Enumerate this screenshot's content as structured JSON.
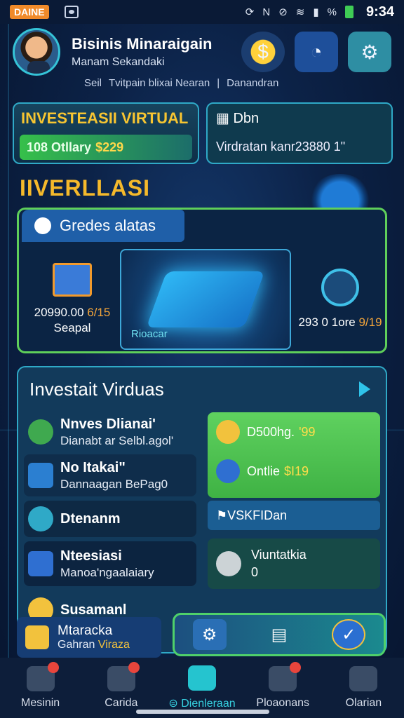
{
  "status": {
    "carrier": "DAINE",
    "time": "9:34",
    "icons": [
      "sync-icon",
      "n-icon",
      "signal-off-icon",
      "wifi-icon",
      "signal-icon",
      "percent-icon",
      "battery-icon"
    ]
  },
  "header": {
    "title": "Bisinis Minaraigain",
    "subtitle": "Manam Sekandaki",
    "icons": [
      "coin-badge-icon",
      "chart-bulb-icon",
      "gear-icon"
    ]
  },
  "subnav": {
    "item1": "Seil",
    "item2": "Tvitpain blixai Nearan",
    "item3": "Danandran"
  },
  "top_cards": {
    "invest_title": "INVESTEASII VIRTUAL",
    "invest_value_label": "108 Otllary",
    "invest_value_amount": "$229",
    "dbn_title": "Dbn",
    "dbn_value": "Virdratan kanr23880 1\""
  },
  "section": {
    "title": "IIVERLLASI"
  },
  "panel": {
    "tab": "Gredes alatas",
    "left_value": "20990.00",
    "left_value_orange": "6/15",
    "left_caption": "Seapal",
    "center_caption": "Rioacar",
    "right_value": "293 0 1ore",
    "right_value_orange": "9/19"
  },
  "invest": {
    "title": "Investait Virduas",
    "rows": [
      {
        "title": "Nnves Dlianai'",
        "sub": "Dianabt ar Selbl.agol'"
      },
      {
        "title": "No Itakai\"",
        "sub": "Dannaagan BePag0"
      },
      {
        "title": "Dtenanm",
        "sub": ""
      },
      {
        "title": "Nteesiasi",
        "sub": "Manoa'ngaalaiary"
      },
      {
        "title": "Susamanl",
        "sub": ""
      }
    ],
    "green_line1": "D500hg.",
    "green_line1_amount": "'99",
    "green_line2": "Ontlie",
    "green_line2_amount": "$I19",
    "footer": "VSKFIDan",
    "vbox_title": "Viuntatkia",
    "vbox_value": "0"
  },
  "bottom_card": {
    "title": "Mtaracka",
    "sub": "Gahran",
    "sub_highlight": "Viraza"
  },
  "nav": [
    {
      "label": "Mesinin",
      "active": false
    },
    {
      "label": "Carida",
      "active": false
    },
    {
      "label": "Dienleraan",
      "active": true
    },
    {
      "label": "Ploaonans",
      "active": false
    },
    {
      "label": "Olarian",
      "active": false
    }
  ],
  "colors": {
    "accent": "#37d1e0",
    "gold": "#f7c531",
    "green": "#5fcf5a",
    "panel": "#123a5b"
  }
}
